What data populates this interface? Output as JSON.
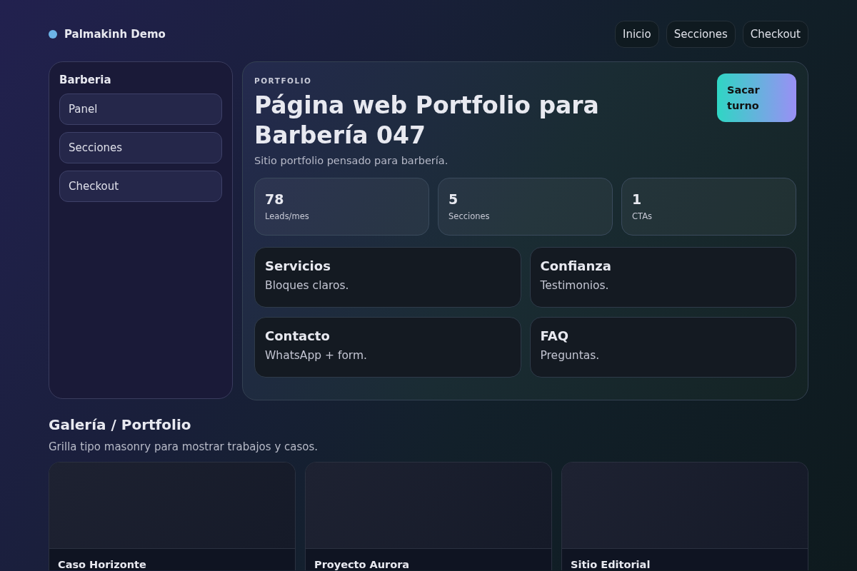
{
  "brand": {
    "name": "Palmakinh Demo"
  },
  "nav": [
    {
      "label": "Inicio"
    },
    {
      "label": "Secciones"
    },
    {
      "label": "Checkout"
    }
  ],
  "sidebar": {
    "title": "Barberia",
    "items": [
      {
        "label": "Panel"
      },
      {
        "label": "Secciones"
      },
      {
        "label": "Checkout"
      }
    ]
  },
  "hero": {
    "eyebrow": "PORTFOLIO",
    "title": "Página web Portfolio para Barbería 047",
    "subtitle": "Sitio portfolio pensado para barbería.",
    "cta": "Sacar turno",
    "stats": [
      {
        "value": "78",
        "label": "Leads/mes"
      },
      {
        "value": "5",
        "label": "Secciones"
      },
      {
        "value": "1",
        "label": "CTAs"
      }
    ],
    "features": [
      {
        "title": "Servicios",
        "text": "Bloques claros."
      },
      {
        "title": "Confianza",
        "text": "Testimonios."
      },
      {
        "title": "Contacto",
        "text": "WhatsApp + form."
      },
      {
        "title": "FAQ",
        "text": "Preguntas."
      }
    ]
  },
  "gallery": {
    "title": "Galería / Portfolio",
    "subtitle": "Grilla tipo masonry para mostrar trabajos y casos.",
    "cards": [
      {
        "title": "Caso Horizonte"
      },
      {
        "title": "Proyecto Aurora"
      },
      {
        "title": "Sitio Editorial"
      }
    ]
  }
}
